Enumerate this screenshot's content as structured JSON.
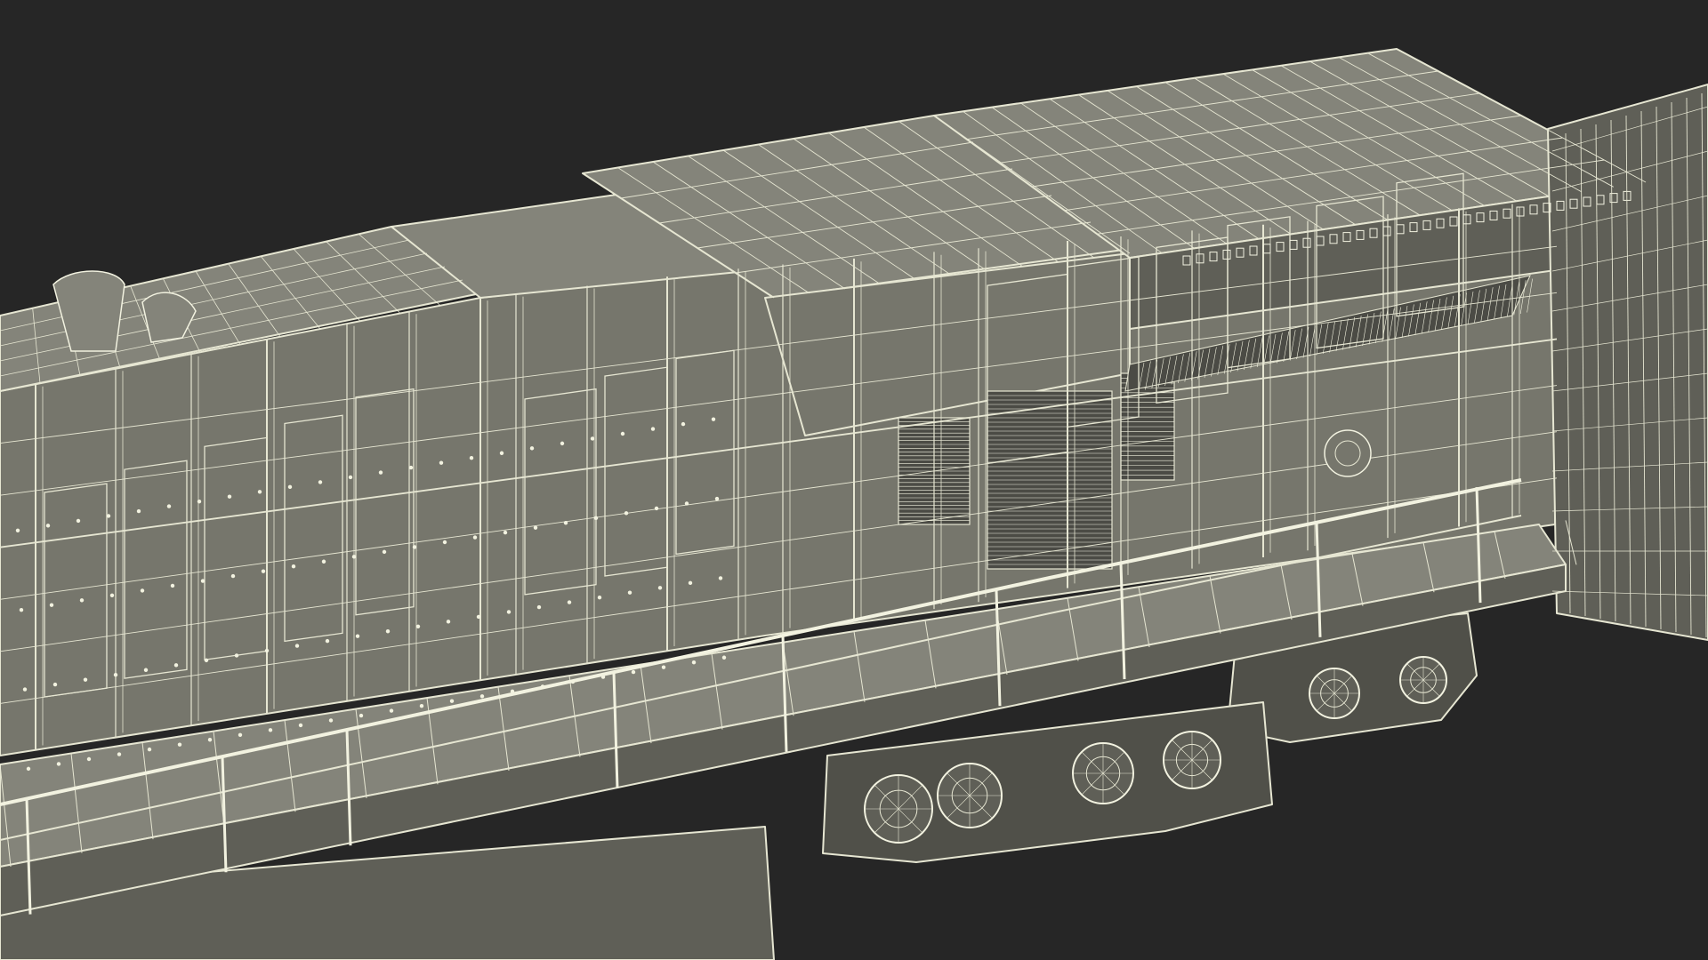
{
  "scene": {
    "subject": "wireframe-locomotive",
    "colors": {
      "background": "#262626",
      "body_fill": "#76766c",
      "body_fill_light": "#84847a",
      "body_fill_dark": "#5f5f57",
      "body_fill_shadow": "#505049",
      "wire": "#e6e6d2",
      "wire_dense": "#f2f2e0",
      "grille": "#4b4b45"
    }
  }
}
